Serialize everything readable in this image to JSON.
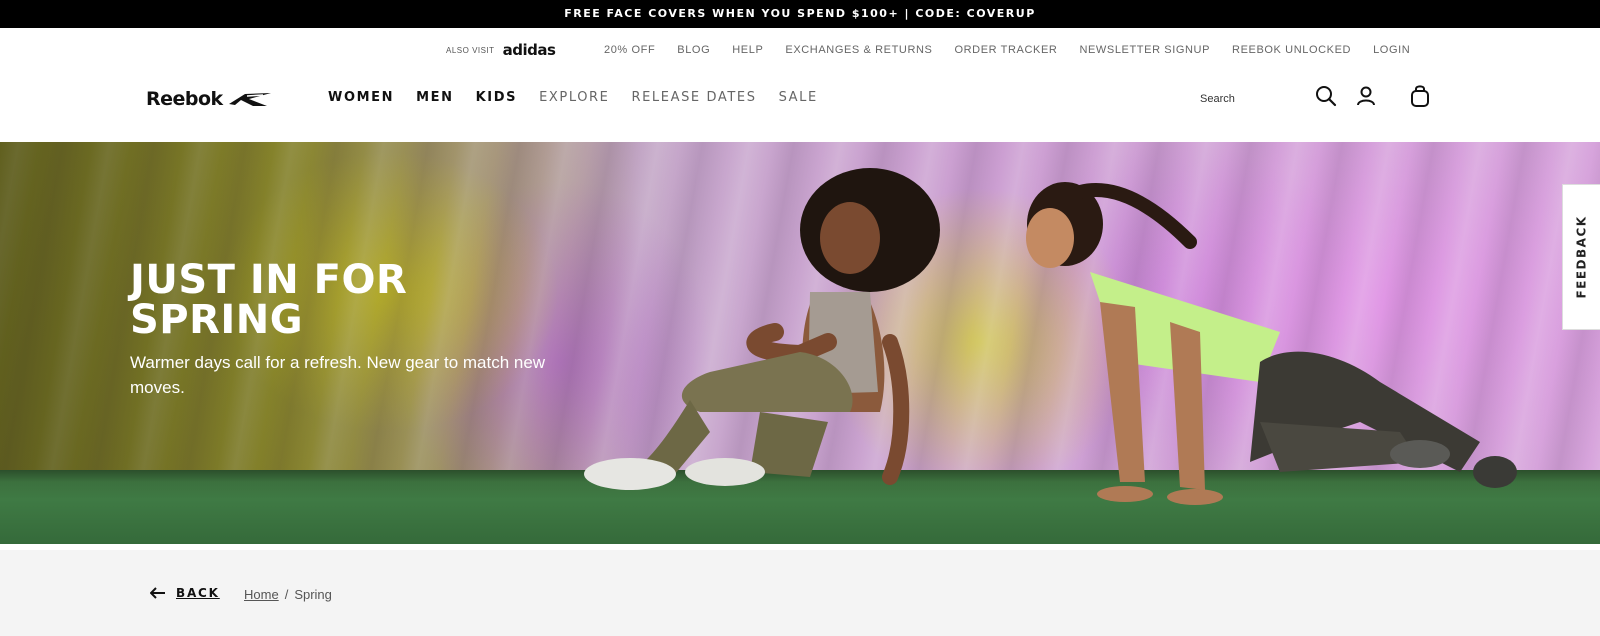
{
  "promo": {
    "text": "FREE FACE COVERS WHEN YOU SPEND $100+ | CODE: COVERUP"
  },
  "utility": {
    "also_visit": "ALSO VISIT",
    "partner_brand": "adidas",
    "links": [
      "20% OFF",
      "BLOG",
      "HELP",
      "EXCHANGES & RETURNS",
      "ORDER TRACKER",
      "NEWSLETTER SIGNUP",
      "REEBOK UNLOCKED",
      "LOGIN"
    ]
  },
  "nav": {
    "brand": "Reebok",
    "primary": [
      "WOMEN",
      "MEN",
      "KIDS"
    ],
    "secondary": [
      "EXPLORE",
      "RELEASE DATES",
      "SALE"
    ],
    "search_placeholder": "Search",
    "icons": [
      "search-icon",
      "account-icon",
      "bag-icon"
    ]
  },
  "hero": {
    "title_line1": "JUST IN FOR",
    "title_line2": "SPRING",
    "subtitle": "Warmer days call for a refresh. New gear to match new moves."
  },
  "feedback": {
    "label": "FEEDBACK"
  },
  "breadcrumb": {
    "back_label": "BACK",
    "home": "Home",
    "separator": "/",
    "current": "Spring"
  },
  "colors": {
    "promo_bg": "#000000",
    "text_primary": "#111111",
    "text_muted": "#666666",
    "hero_floor": "#3f7a44",
    "breadcrumb_bg": "#f4f4f4"
  }
}
